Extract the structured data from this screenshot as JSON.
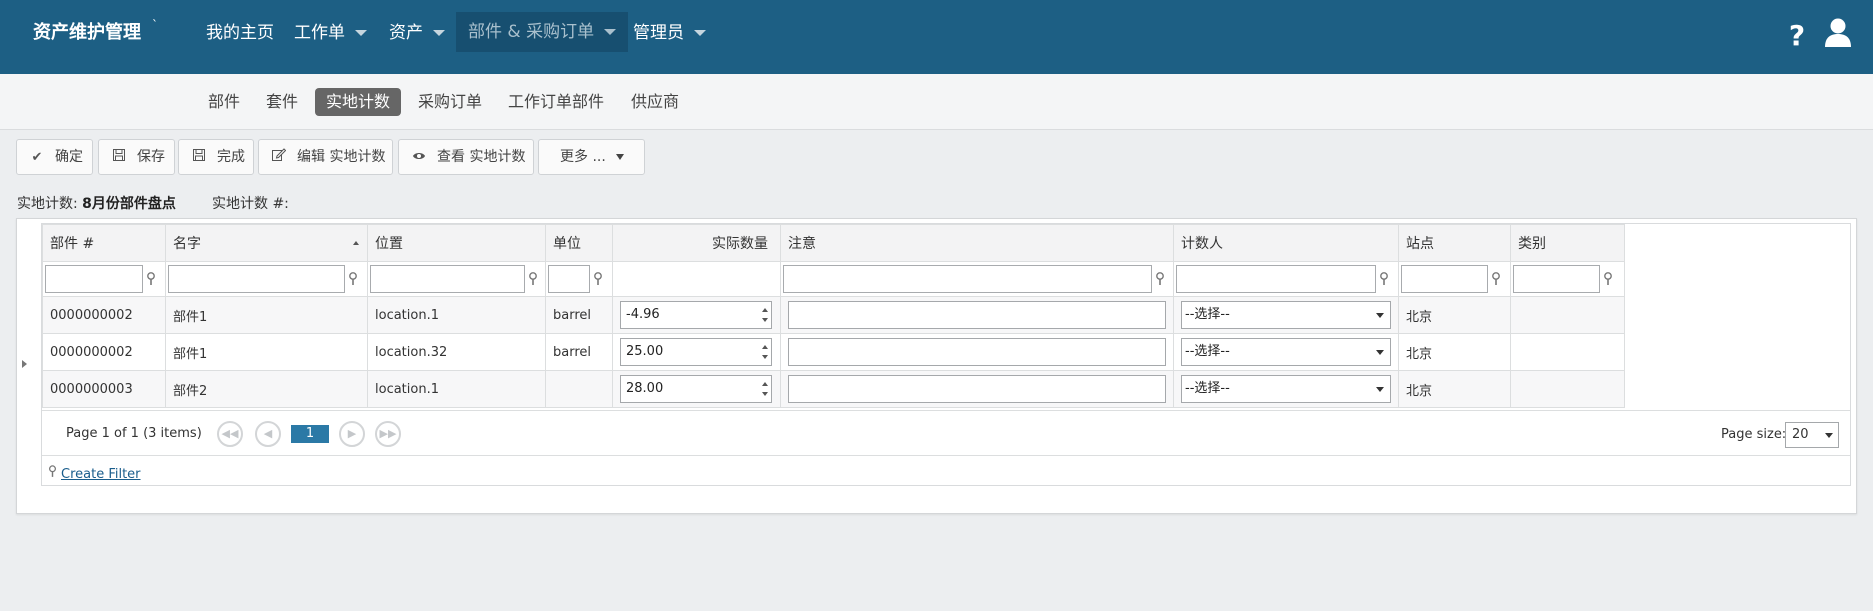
{
  "app": {
    "title": "资产维护管理",
    "title_mark": "`"
  },
  "nav": [
    {
      "label": "我的主页",
      "has_caret": false
    },
    {
      "label": "工作单",
      "has_caret": true
    },
    {
      "label": "资产",
      "has_caret": true
    },
    {
      "label": "部件 & 采购订单",
      "has_caret": true,
      "active": true
    },
    {
      "label": "管理员",
      "has_caret": true
    }
  ],
  "topicons": {
    "help": "?",
    "help_icon": "help-icon",
    "user_icon": "user-icon"
  },
  "subnav": [
    {
      "label": "部件"
    },
    {
      "label": "套件"
    },
    {
      "label": "实地计数",
      "active": true
    },
    {
      "label": "采购订单"
    },
    {
      "label": "工作订单部件"
    },
    {
      "label": "供应商"
    }
  ],
  "toolbar": {
    "confirm": "确定",
    "save": "保存",
    "complete": "完成",
    "edit": "编辑 实地计数",
    "view": "查看 实地计数",
    "more": "更多 ..."
  },
  "info": {
    "count_label": "实地计数:",
    "count_value": "8月份部件盘点",
    "number_label": "实地计数 #:",
    "number_value": ""
  },
  "grid": {
    "columns": {
      "part_no": "部件 #",
      "name": "名字",
      "location": "位置",
      "unit": "单位",
      "actual_qty": "实际数量",
      "note": "注意",
      "counter": "计数人",
      "site": "站点",
      "category": "类别"
    },
    "rows": [
      {
        "part_no": "0000000002",
        "name": "部件1",
        "location": "location.1",
        "unit": "barrel",
        "actual_qty": "-4.96",
        "note": "",
        "counter": "--选择--",
        "site": "北京",
        "category": ""
      },
      {
        "part_no": "0000000002",
        "name": "部件1",
        "location": "location.32",
        "unit": "barrel",
        "actual_qty": "25.00",
        "note": "",
        "counter": "--选择--",
        "site": "北京",
        "category": ""
      },
      {
        "part_no": "0000000003",
        "name": "部件2",
        "location": "location.1",
        "unit": "",
        "actual_qty": "28.00",
        "note": "",
        "counter": "--选择--",
        "site": "北京",
        "category": ""
      }
    ],
    "pager": {
      "summary": "Page 1 of 1 (3 items)",
      "current_page": "1",
      "page_size_label": "Page size:",
      "page_size": "20"
    },
    "create_filter": "Create Filter"
  },
  "colors": {
    "topbar": "#1d5f84",
    "active_nav": "#174f70",
    "active_tab": "#666666",
    "pager_active": "#2b79a6"
  }
}
